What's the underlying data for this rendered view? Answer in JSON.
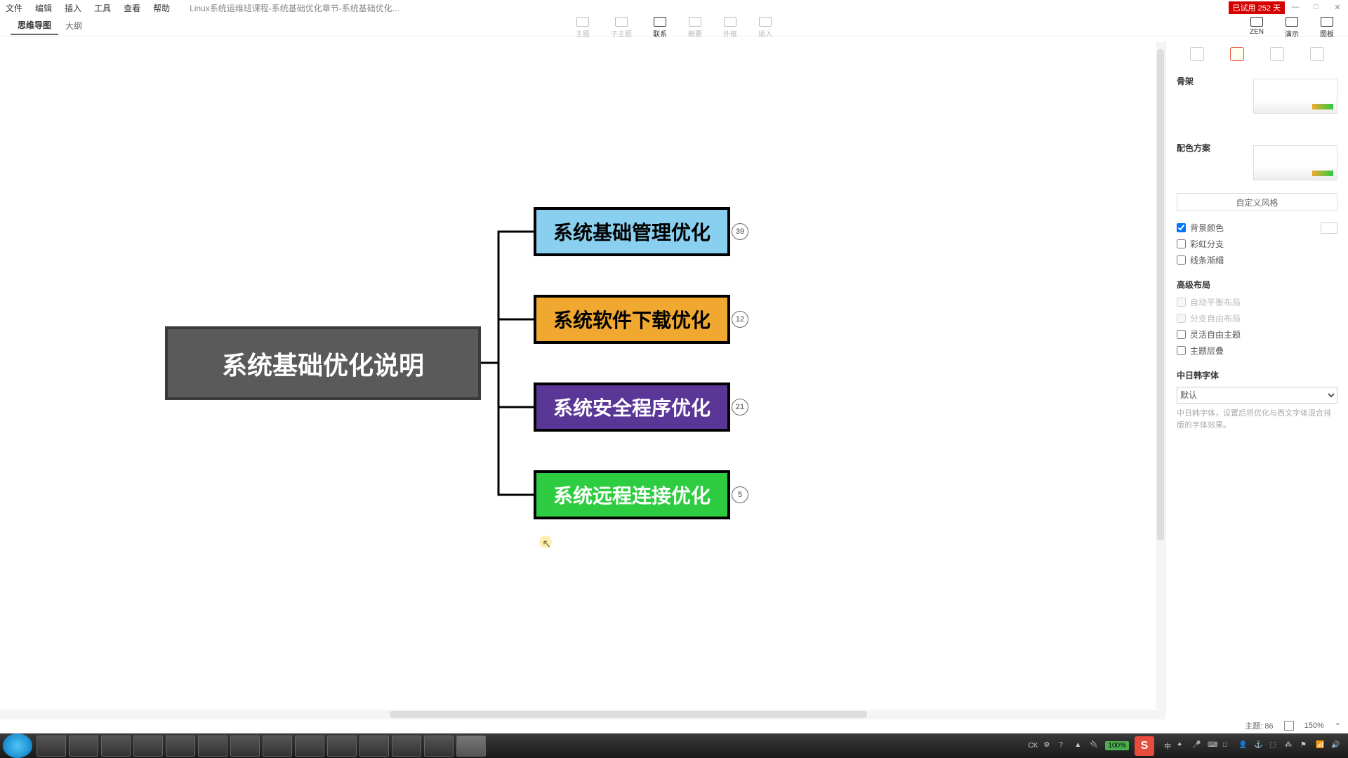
{
  "menu": {
    "file": "文件",
    "edit": "编辑",
    "insert": "插入",
    "tools": "工具",
    "view": "查看",
    "help": "帮助"
  },
  "title": "Linux系统运维班课程-系统基础优化章节-系统基础优化...",
  "trial": "已试用 252 天",
  "tabs": {
    "mindmap": "思维导图",
    "outline": "大纲"
  },
  "toolbar": {
    "topic": "主题",
    "subtopic": "子主题",
    "relation": "联系",
    "summary": "概要",
    "boundary": "外框",
    "insert": "插入",
    "zen": "ZEN",
    "present": "演示",
    "map": "图板"
  },
  "mindmap": {
    "root": "系统基础优化说明",
    "children": [
      {
        "label": "系统基础管理优化",
        "count": "39"
      },
      {
        "label": "系统软件下载优化",
        "count": "12"
      },
      {
        "label": "系统安全程序优化",
        "count": "21"
      },
      {
        "label": "系统远程连接优化",
        "count": "5"
      }
    ]
  },
  "panel": {
    "skeleton": "骨架",
    "colorscheme": "配色方案",
    "custom": "自定义风格",
    "bgcolor": "背景颜色",
    "rainbow": "彩虹分支",
    "tapered": "线条渐细",
    "advlayout": "高级布局",
    "autobalance": "自动平衡布局",
    "freeform": "分支自由布局",
    "flextopic": "灵活自由主题",
    "overlap": "主题层叠",
    "cjkfont": "中日韩字体",
    "fontdefault": "默认",
    "fonthint": "中日韩字体，设置后将优化与西文字体混合排版的字体效果。"
  },
  "status": {
    "topics_label": "主题:",
    "topics": "86",
    "zoom": "150%"
  },
  "tray": {
    "lang": "CK",
    "ime": "中",
    "battery": "100%"
  }
}
